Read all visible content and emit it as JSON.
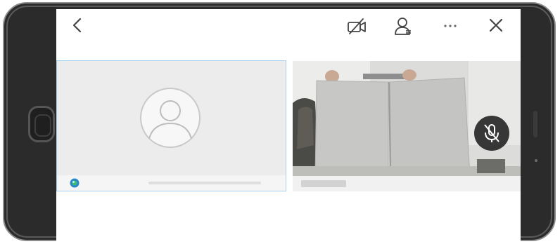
{
  "toolbar": {
    "back_icon": "chevron-left-icon",
    "camera_icon": "camera-off-icon",
    "participants_icon": "user-icon",
    "more_icon": "more-horizontal-icon",
    "close_icon": "close-icon"
  },
  "local_video": {
    "placeholder_icon": "avatar-placeholder-icon",
    "status_icon": "network-status-icon"
  },
  "remote_video": {
    "muted_icon": "mic-off-icon"
  },
  "colors": {
    "icon": "#444444",
    "active_tile_border": "#a8d1f0",
    "tile_background": "#ececec",
    "phone_frame": "#2b2b2b"
  }
}
